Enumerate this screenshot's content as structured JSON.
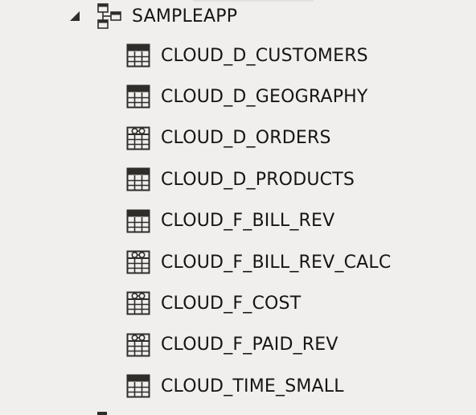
{
  "tree": {
    "schema": {
      "name": "SAMPLEAPP",
      "expanded": true,
      "icon": "schema-icon"
    },
    "objects": [
      {
        "name": "CLOUD_D_CUSTOMERS",
        "kind": "table",
        "icon": "table-icon"
      },
      {
        "name": "CLOUD_D_GEOGRAPHY",
        "kind": "table",
        "icon": "table-icon"
      },
      {
        "name": "CLOUD_D_ORDERS",
        "kind": "view",
        "icon": "view-icon"
      },
      {
        "name": "CLOUD_D_PRODUCTS",
        "kind": "table",
        "icon": "table-icon"
      },
      {
        "name": "CLOUD_F_BILL_REV",
        "kind": "table",
        "icon": "table-icon"
      },
      {
        "name": "CLOUD_F_BILL_REV_CALC",
        "kind": "view",
        "icon": "view-icon"
      },
      {
        "name": "CLOUD_F_COST",
        "kind": "view",
        "icon": "view-icon"
      },
      {
        "name": "CLOUD_F_PAID_REV",
        "kind": "view",
        "icon": "view-icon"
      },
      {
        "name": "CLOUD_TIME_SMALL",
        "kind": "table",
        "icon": "table-icon"
      }
    ]
  },
  "colors": {
    "background": "#f0efed",
    "text": "#161513",
    "icon": "#2f2d2a"
  }
}
